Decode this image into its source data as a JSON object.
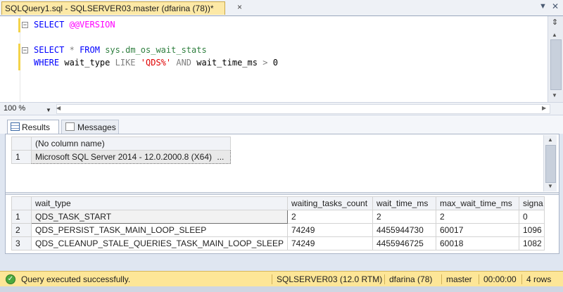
{
  "tab": {
    "title": "SQLQuery1.sql - SQLSERVER03.master (dfarina (78))*",
    "close_glyph": "×"
  },
  "editor": {
    "line1": {
      "kw": "SELECT",
      "var": "@@VERSION"
    },
    "line2": {
      "kw1": "SELECT",
      "star": "*",
      "kw2": "FROM",
      "sys": "sys.dm_os_wait_stats"
    },
    "line3": {
      "kw1": "WHERE",
      "col1": "wait_type",
      "op1": "LIKE",
      "str": "'QDS%'",
      "op2": "AND",
      "col2": "wait_time_ms",
      "gt": ">",
      "num": "0"
    }
  },
  "zoom": {
    "value": "100 %"
  },
  "result_tabs": [
    {
      "label": "Results"
    },
    {
      "label": "Messages"
    }
  ],
  "grid1": {
    "header": "(No column name)",
    "rows": [
      {
        "num": "1",
        "value": "Microsoft SQL Server 2014 - 12.0.2000.8 (X64)",
        "more": "..."
      }
    ]
  },
  "grid2": {
    "headers": [
      "wait_type",
      "waiting_tasks_count",
      "wait_time_ms",
      "max_wait_time_ms",
      "signa"
    ],
    "rows": [
      {
        "num": "1",
        "cells": [
          "QDS_TASK_START",
          "2",
          "2",
          "2",
          "0"
        ]
      },
      {
        "num": "2",
        "cells": [
          "QDS_PERSIST_TASK_MAIN_LOOP_SLEEP",
          "74249",
          "4455944730",
          "60017",
          "1096"
        ]
      },
      {
        "num": "3",
        "cells": [
          "QDS_CLEANUP_STALE_QUERIES_TASK_MAIN_LOOP_SLEEP",
          "74249",
          "4455946725",
          "60018",
          "1082"
        ]
      }
    ]
  },
  "status": {
    "message": "Query executed successfully.",
    "server": "SQLSERVER03 (12.0 RTM)",
    "user": "dfarina (78)",
    "database": "master",
    "elapsed": "00:00:00",
    "rows": "4 rows"
  }
}
